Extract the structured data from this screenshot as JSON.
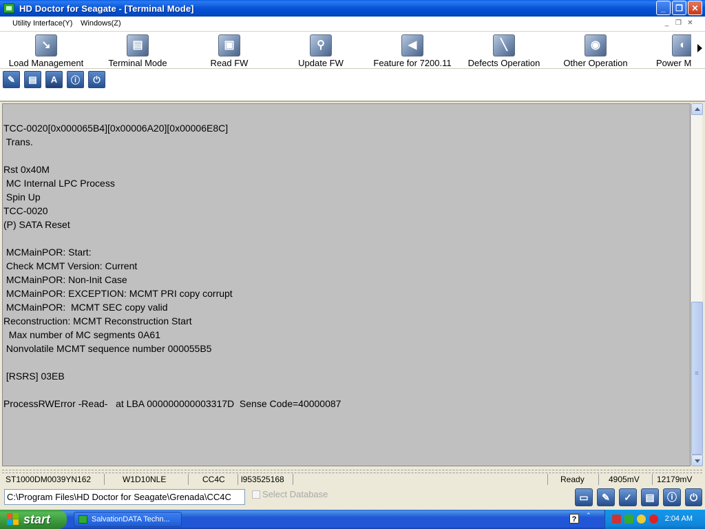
{
  "window": {
    "title": "HD Doctor for Seagate - [Terminal Mode]",
    "minimize": "_",
    "restore": "❐",
    "close": "✕"
  },
  "menu": {
    "items": [
      "Utility Interface(Y)",
      "Windows(Z)"
    ],
    "mdi_minimize": "_",
    "mdi_restore": "❐",
    "mdi_close": "✕"
  },
  "toolbar": {
    "items": [
      {
        "label": "Load Management",
        "icon": "load-management-icon"
      },
      {
        "label": "Terminal Mode",
        "icon": "terminal-mode-icon"
      },
      {
        "label": "Read FW",
        "icon": "read-fw-icon"
      },
      {
        "label": "Update FW",
        "icon": "update-fw-icon"
      },
      {
        "label": "Feature for 7200.11",
        "icon": "feature-icon"
      },
      {
        "label": "Defects Operation",
        "icon": "defects-icon"
      },
      {
        "label": "Other Operation",
        "icon": "other-operation-icon"
      },
      {
        "label": "Power M",
        "icon": "power-icon"
      }
    ]
  },
  "small_toolbar": {
    "buttons": [
      "edit-icon",
      "save-icon",
      "font-icon",
      "info-icon",
      "power-icon"
    ],
    "font_glyph": "A"
  },
  "terminal": {
    "lines": [
      "TCC-0020[0x000065B4][0x00006A20][0x00006E8C]",
      " Trans.",
      "",
      "Rst 0x40M",
      " MC Internal LPC Process",
      " Spin Up",
      "TCC-0020",
      "(P) SATA Reset",
      "",
      " MCMainPOR: Start:",
      " Check MCMT Version: Current",
      " MCMainPOR: Non-Init Case",
      " MCMainPOR: EXCEPTION: MCMT PRI copy corrupt",
      " MCMainPOR:  MCMT SEC copy valid",
      "Reconstruction: MCMT Reconstruction Start",
      "  Max number of MC segments 0A61",
      " Nonvolatile MCMT sequence number 000055B5",
      "",
      " [RSRS] 03EB",
      "",
      "ProcessRWError -Read-   at LBA 000000000003317D  Sense Code=40000087"
    ]
  },
  "status": {
    "model": "ST1000DM0039YN162",
    "serial": "W1D10NLE",
    "firmware": "CC4C",
    "id": "l953525168",
    "state": "Ready",
    "voltage_5v": "4905mV",
    "voltage_12v": "12179mV"
  },
  "path": {
    "value": "C:\\Program Files\\HD Doctor for Seagate\\Grenada\\CC4C",
    "db_label": "Select Database"
  },
  "taskbar": {
    "start_label": "start",
    "task_label": "SalvationDATA Techn...",
    "help_glyph": "?",
    "tray_arrow": "⌃",
    "clock": "2:04 AM"
  }
}
